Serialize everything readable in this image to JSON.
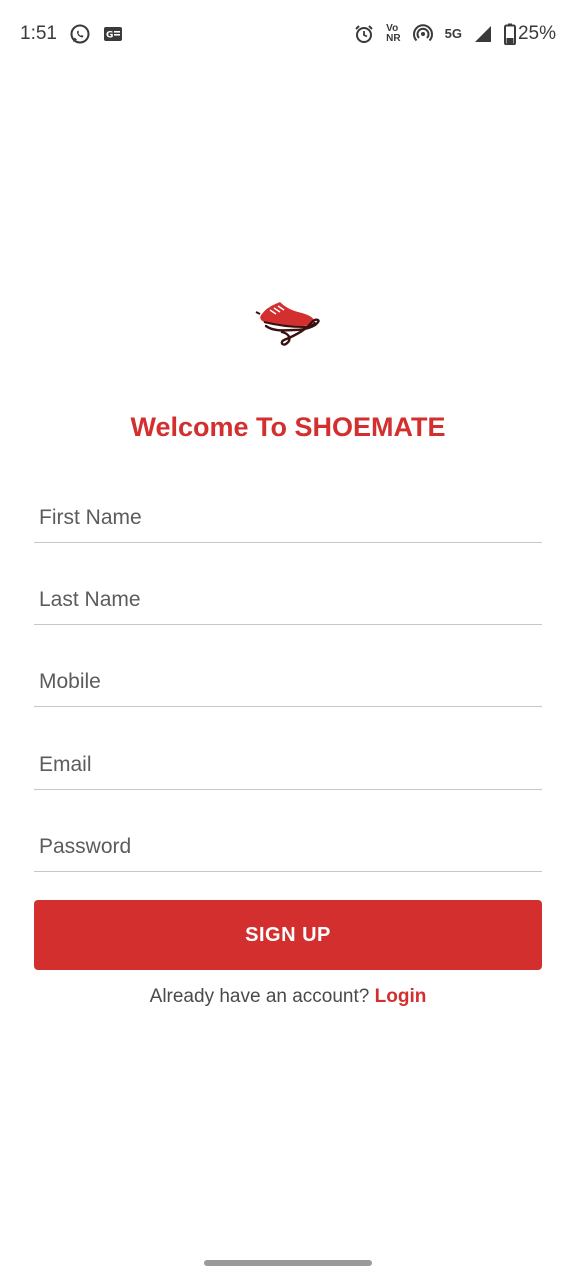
{
  "status_bar": {
    "time": "1:51",
    "icons_left": [
      "whatsapp-icon",
      "news-icon"
    ],
    "icons_right": [
      "alarm-icon",
      "volte-icon",
      "hotspot-icon",
      "5g-icon",
      "signal-icon",
      "battery-icon"
    ],
    "volte_line1": "Vo",
    "volte_line2": "NR",
    "network": "5G",
    "battery": "25%"
  },
  "app": {
    "logo_icon": "sneaker-logo-icon",
    "welcome_text": "Welcome To SHOEMATE",
    "brand_color": "#d32f2f"
  },
  "form": {
    "first_name": {
      "value": "",
      "placeholder": "First Name"
    },
    "last_name": {
      "value": "",
      "placeholder": "Last Name"
    },
    "mobile": {
      "value": "",
      "placeholder": "Mobile"
    },
    "email": {
      "value": "",
      "placeholder": "Email"
    },
    "password": {
      "value": "",
      "placeholder": "Password"
    },
    "signup_label": "SIGN UP"
  },
  "footer": {
    "prompt": "Already have an account?",
    "login_label": "Login"
  }
}
